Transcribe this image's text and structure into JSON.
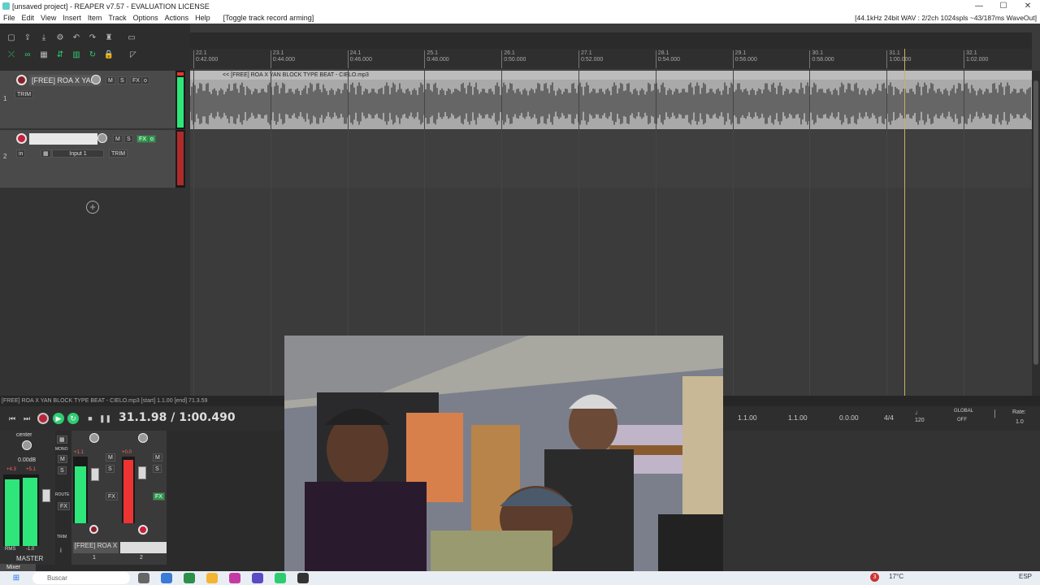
{
  "window": {
    "title": "[unsaved project] - REAPER v7.57 - EVALUATION LICENSE",
    "controls": {
      "minimize": "—",
      "maximize": "☐",
      "close": "✕"
    }
  },
  "menu": {
    "items": [
      "File",
      "Edit",
      "View",
      "Insert",
      "Item",
      "Track",
      "Options",
      "Actions",
      "Help",
      "[Toggle track record arming]"
    ],
    "status": "[44.1kHz 24bit WAV : 2/2ch 1024spls ~43/187ms WaveOut]"
  },
  "ruler": {
    "ticks": [
      {
        "bar": "22.1",
        "time": "0:42.000"
      },
      {
        "bar": "23.1",
        "time": "0:44.000"
      },
      {
        "bar": "24.1",
        "time": "0:46.000"
      },
      {
        "bar": "25.1",
        "time": "0:48.000"
      },
      {
        "bar": "26.1",
        "time": "0:50.000"
      },
      {
        "bar": "27.1",
        "time": "0:52.000"
      },
      {
        "bar": "28.1",
        "time": "0:54.000"
      },
      {
        "bar": "29.1",
        "time": "0:56.000"
      },
      {
        "bar": "30.1",
        "time": "0:58.000"
      },
      {
        "bar": "31.1",
        "time": "1:00.000"
      },
      {
        "bar": "32.1",
        "time": "1:02.000"
      }
    ]
  },
  "tracks": [
    {
      "number": "1",
      "name": "[FREE] ROA X YAN",
      "mute": "M",
      "solo": "S",
      "fx": "FX",
      "trim": "TRIM"
    },
    {
      "number": "2",
      "name": "",
      "mute": "M",
      "solo": "S",
      "fx": "FX",
      "input": "Input 1",
      "in": "in",
      "trim": "TRIM"
    }
  ],
  "item": {
    "name": "<< [FREE] ROA X YAN BLOCK TYPE BEAT - CIELO.mp3"
  },
  "add_track": "+",
  "status_line": "[FREE] ROA X YAN BLOCK TYPE BEAT - CIELO.mp3 [start] 1.1.00 [end] 71.3.59",
  "transport": {
    "time": "31.1.98 / 1:00.490",
    "start": "1.1.00",
    "end": "1.1.00",
    "length": "0.0.00",
    "signature": "4/4",
    "bpm": "120",
    "global_label": "GLOBAL",
    "global_state": "OFF",
    "rate_label": "Rate:",
    "rate": "1.0"
  },
  "mixer": {
    "master": {
      "pan": "center",
      "volume": "0.00dB",
      "peak_l": "+4.3",
      "peak_r": "+5.1",
      "rms": "RMS",
      "rms_value": "-1.0",
      "name": "MASTER",
      "mono": "MONO",
      "route": "ROUTE",
      "fx": "FX",
      "trim": "TRIM"
    },
    "strips": [
      {
        "name": "[FREE] ROA X",
        "peak": "+1.1",
        "number": "1",
        "level": 0.85
      },
      {
        "name": "",
        "peak": "+0.0",
        "number": "2",
        "level": 0.95
      }
    ],
    "tab": "Mixer"
  },
  "taskbar": {
    "search_placeholder": "Buscar",
    "temperature": "17°C",
    "notification_count": "3",
    "language": "ESP"
  }
}
